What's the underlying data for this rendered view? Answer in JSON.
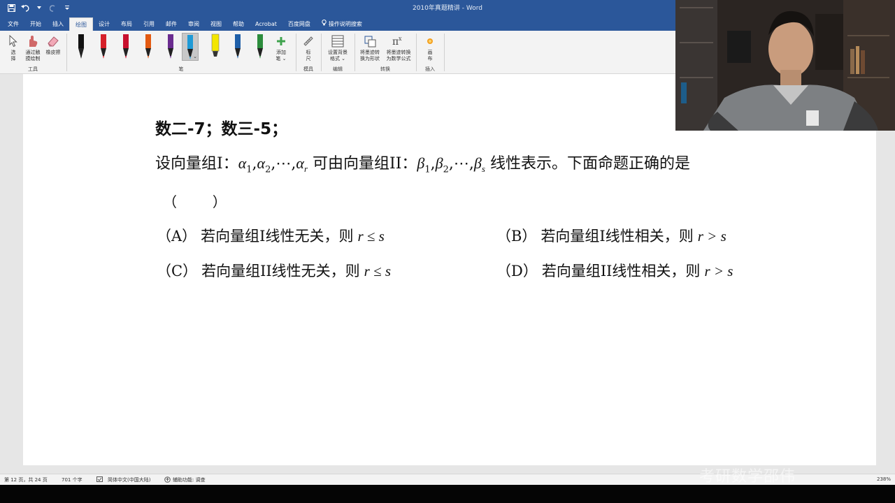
{
  "window": {
    "title": "2010年真题精讲  -  Word"
  },
  "quick_access": {
    "icons": [
      "save-icon",
      "undo-icon",
      "redo-icon",
      "customize-icon"
    ]
  },
  "tabs": [
    {
      "label": "文件"
    },
    {
      "label": "开始"
    },
    {
      "label": "插入"
    },
    {
      "label": "绘图",
      "active": true
    },
    {
      "label": "设计"
    },
    {
      "label": "布局"
    },
    {
      "label": "引用"
    },
    {
      "label": "邮件"
    },
    {
      "label": "审阅"
    },
    {
      "label": "视图"
    },
    {
      "label": "帮助"
    },
    {
      "label": "Acrobat"
    },
    {
      "label": "百度网盘"
    },
    {
      "label": "操作说明搜索"
    }
  ],
  "ribbon": {
    "tools": {
      "select_line1": "选",
      "select_line2": "择",
      "touch_draw_line1": "通过触",
      "touch_draw_line2": "摸绘制",
      "eraser": "橡皮擦",
      "group": "工具"
    },
    "pens": {
      "colors": [
        "#111111",
        "#d6202a",
        "#c8102e",
        "#e35a12",
        "#6a2c8f",
        "#1f9ad6",
        "#f3e600",
        "#1f5fa8",
        "#2c8c3c"
      ],
      "selected_index": 5,
      "add_pen_line1": "添加",
      "add_pen_line2": "笔 ⌄",
      "group": "笔"
    },
    "stencils": {
      "ruler_line1": "标",
      "ruler_line2": "尺",
      "group": "模具"
    },
    "edit": {
      "bg_line1": "设置背景",
      "bg_line2": "格式 ⌄",
      "group": "编辑"
    },
    "convert": {
      "to_shape_line1": "将墨迹转",
      "to_shape_line2": "换为形状",
      "to_math_line1": "将墨迹转换",
      "to_math_line2": "为数学公式",
      "group": "转换"
    },
    "insert": {
      "canvas_line1": "画",
      "canvas_line2": "布",
      "group": "插入"
    }
  },
  "document": {
    "heading": "数二-7；数三-5；",
    "stem_prefix": "设向量组I：",
    "stem_middle": "可由向量组II：",
    "stem_suffix": "线性表示。下面命题正确的是",
    "blank": "（        ）",
    "options": [
      {
        "label": "（A）",
        "text": "若向量组I线性无关，则",
        "relation": "r ≤ s"
      },
      {
        "label": "（B）",
        "text": "若向量组I线性相关，则",
        "relation": "r > s"
      },
      {
        "label": "（C）",
        "text": "若向量组II线性无关，则",
        "relation": "r ≤ s"
      },
      {
        "label": "（D）",
        "text": "若向量组II线性相关，则",
        "relation": "r > s"
      }
    ]
  },
  "status": {
    "page": "第 12 页，共 24 页",
    "words": "701 个字",
    "language": "简体中文(中国大陆)",
    "accessibility": "辅助功能: 调查",
    "zoom": "238%"
  },
  "watermark": "考研数学邵伟"
}
